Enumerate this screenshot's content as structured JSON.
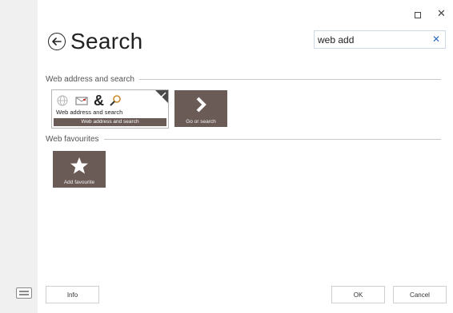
{
  "window": {
    "restore_icon": "restore-icon",
    "close_glyph": "✕"
  },
  "header": {
    "back_icon": "back-arrow-circle-icon",
    "title": "Search"
  },
  "search": {
    "value": "web add",
    "clear_glyph": "✕"
  },
  "sections": [
    {
      "label": "Web address and search",
      "tiles": [
        {
          "kind": "large",
          "title": "Web address and search",
          "bar_label": "Web address and search",
          "icons": [
            "globe-icon",
            "email-icon",
            "ampersand-icon",
            "magnifier-icon"
          ],
          "ampersand": "&",
          "selected": true
        },
        {
          "kind": "small",
          "label": "Go or search",
          "icon": "chevron-right-icon"
        }
      ]
    },
    {
      "label": "Web favourites",
      "tiles": [
        {
          "kind": "small",
          "label": "Add favourite",
          "icon": "star-icon"
        }
      ]
    }
  ],
  "footer": {
    "info_label": "Info",
    "ok_label": "OK",
    "cancel_label": "Cancel"
  },
  "colors": {
    "tile_bg": "#6b5b57",
    "accent": "#2a6cc9",
    "sidebar_bg": "#f0f0f0"
  }
}
